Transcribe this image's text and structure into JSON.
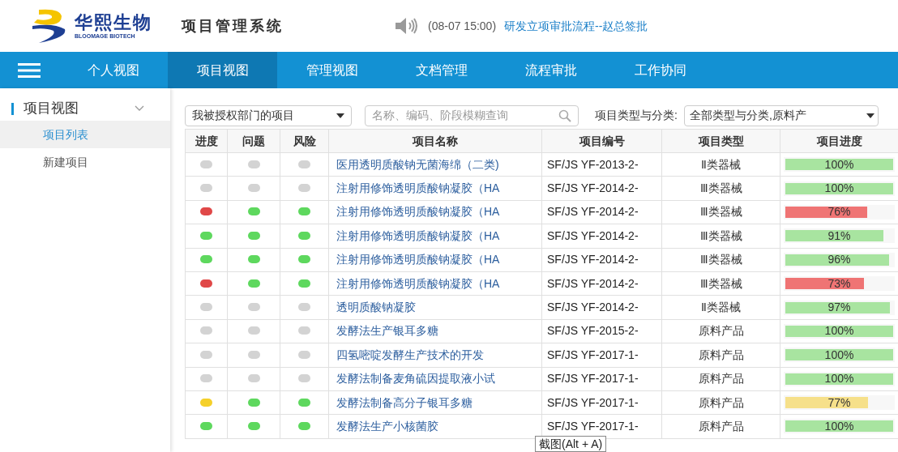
{
  "header": {
    "brand": "华熙生物",
    "brand_en": "BLOOMAGE BIOTECH",
    "title": "项目管理系统",
    "notice_time": "(08-07 15:00)",
    "notice_link": "研发立项审批流程--赵总签批"
  },
  "nav": [
    {
      "label": "个人视图",
      "selected": false
    },
    {
      "label": "项目视图",
      "selected": true
    },
    {
      "label": "管理视图",
      "selected": false
    },
    {
      "label": "文档管理",
      "selected": false
    },
    {
      "label": "流程审批",
      "selected": false
    },
    {
      "label": "工作协同",
      "selected": false
    }
  ],
  "sidebar": {
    "section": "项目视图",
    "expanded": true,
    "items": [
      {
        "label": "项目列表",
        "selected": true
      },
      {
        "label": "新建项目",
        "selected": false
      }
    ]
  },
  "filters": {
    "scope": "我被授权部门的项目",
    "search_placeholder": "名称、编码、阶段模糊查询",
    "type_label": "项目类型与分类:",
    "type_value": "全部类型与分类,原料产"
  },
  "table": {
    "columns": [
      "进度",
      "问题",
      "风险",
      "项目名称",
      "项目编号",
      "项目类型",
      "项目进度"
    ],
    "rows": [
      {
        "indicators": [
          {
            "color": "#d3d3d3"
          },
          {
            "color": "#d3d3d3"
          },
          {
            "color": "#d3d3d3"
          }
        ],
        "name": "医用透明质酸钠无菌海绵（二类)",
        "code": "SF/JS YF-2013-2-",
        "type": "Ⅱ类器械",
        "progress": {
          "level": 1,
          "reading": "100%",
          "color": "#a8e4a0"
        }
      },
      {
        "indicators": [
          {
            "color": "#d3d3d3"
          },
          {
            "color": "#d3d3d3"
          },
          {
            "color": "#d3d3d3"
          }
        ],
        "name": "注射用修饰透明质酸钠凝胶（HA",
        "code": "SF/JS YF-2014-2-",
        "type": "Ⅲ类器械",
        "progress": {
          "level": 1,
          "reading": "100%",
          "color": "#a8e4a0"
        }
      },
      {
        "indicators": [
          {
            "color": "#e04848"
          },
          {
            "color": "#5ed85e"
          },
          {
            "color": "#5ed85e"
          }
        ],
        "name": "注射用修饰透明质酸钠凝胶（HA",
        "code": "SF/JS YF-2014-2-",
        "type": "Ⅲ类器械",
        "progress": {
          "level": 0.76,
          "reading": "76%",
          "color": "#ef7474"
        }
      },
      {
        "indicators": [
          {
            "color": "#5ed85e"
          },
          {
            "color": "#5ed85e"
          },
          {
            "color": "#5ed85e"
          }
        ],
        "name": "注射用修饰透明质酸钠凝胶（HA",
        "code": "SF/JS YF-2014-2-",
        "type": "Ⅲ类器械",
        "progress": {
          "level": 0.91,
          "reading": "91%",
          "color": "#a8e4a0"
        }
      },
      {
        "indicators": [
          {
            "color": "#5ed85e"
          },
          {
            "color": "#5ed85e"
          },
          {
            "color": "#5ed85e"
          }
        ],
        "name": "注射用修饰透明质酸钠凝胶（HA",
        "code": "SF/JS YF-2014-2-",
        "type": "Ⅲ类器械",
        "progress": {
          "level": 0.96,
          "reading": "96%",
          "color": "#a8e4a0"
        }
      },
      {
        "indicators": [
          {
            "color": "#e04848"
          },
          {
            "color": "#5ed85e"
          },
          {
            "color": "#5ed85e"
          }
        ],
        "name": "注射用修饰透明质酸钠凝胶（HA",
        "code": "SF/JS YF-2014-2-",
        "type": "Ⅲ类器械",
        "progress": {
          "level": 0.73,
          "reading": "73%",
          "color": "#ef7474"
        }
      },
      {
        "indicators": [
          {
            "color": "#d3d3d3"
          },
          {
            "color": "#d3d3d3"
          },
          {
            "color": "#d3d3d3"
          }
        ],
        "name": "透明质酸钠凝胶",
        "code": "SF/JS YF-2014-2-",
        "type": "Ⅱ类器械",
        "progress": {
          "level": 0.97,
          "reading": "97%",
          "color": "#a8e4a0"
        }
      },
      {
        "indicators": [
          {
            "color": "#d3d3d3"
          },
          {
            "color": "#d3d3d3"
          },
          {
            "color": "#d3d3d3"
          }
        ],
        "name": "发酵法生产银耳多糖",
        "code": "SF/JS YF-2015-2-",
        "type": "原料产品",
        "progress": {
          "level": 1,
          "reading": "100%",
          "color": "#a8e4a0"
        }
      },
      {
        "indicators": [
          {
            "color": "#d3d3d3"
          },
          {
            "color": "#d3d3d3"
          },
          {
            "color": "#d3d3d3"
          }
        ],
        "name": "四氢嘧啶发酵生产技术的开发",
        "code": "SF/JS YF-2017-1-",
        "type": "原料产品",
        "progress": {
          "level": 1,
          "reading": "100%",
          "color": "#a8e4a0"
        }
      },
      {
        "indicators": [
          {
            "color": "#d3d3d3"
          },
          {
            "color": "#d3d3d3"
          },
          {
            "color": "#d3d3d3"
          }
        ],
        "name": "发酵法制备麦角硫因提取液小试",
        "code": "SF/JS YF-2017-1-",
        "type": "原料产品",
        "progress": {
          "level": 1,
          "reading": "100%",
          "color": "#a8e4a0"
        }
      },
      {
        "indicators": [
          {
            "color": "#f5d02a"
          },
          {
            "color": "#5ed85e"
          },
          {
            "color": "#5ed85e"
          }
        ],
        "name": "发酵法制备高分子银耳多糖",
        "code": "SF/JS YF-2017-1-",
        "type": "原料产品",
        "progress": {
          "level": 0.77,
          "reading": "77%",
          "color": "#f6e08a"
        }
      },
      {
        "indicators": [
          {
            "color": "#5ed85e"
          },
          {
            "color": "#5ed85e"
          },
          {
            "color": "#5ed85e"
          }
        ],
        "name": "发酵法生产小核菌胶",
        "code": "SF/JS YF-2017-1-",
        "type": "原料产品",
        "progress": {
          "level": 1,
          "reading": "100%",
          "color": "#a8e4a0"
        }
      }
    ]
  },
  "tooltip": "截图(Alt + A)"
}
